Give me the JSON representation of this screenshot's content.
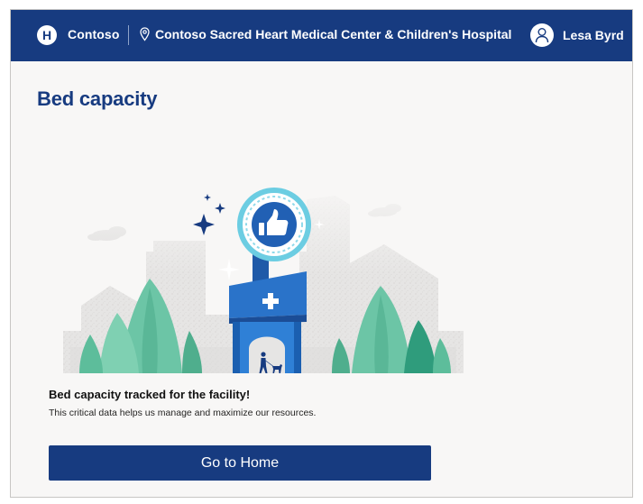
{
  "header": {
    "logo_letter": "H",
    "brand": "Contoso",
    "facility": "Contoso Sacred Heart Medical Center & Children's Hospital",
    "user_name": "Lesa Byrd"
  },
  "page": {
    "title": "Bed capacity"
  },
  "message": {
    "title": "Bed capacity tracked for the facility!",
    "body": "This critical data helps us manage and maximize our resources."
  },
  "actions": {
    "home_label": "Go to Home"
  },
  "colors": {
    "brand_navy": "#173b80",
    "accent_blue": "#2a73c9",
    "badge_cyan": "#6ccde2",
    "tree_green": "#5fbf9e",
    "background": "#f8f7f6"
  },
  "icons": [
    "hospital-logo-icon",
    "location-pin-icon",
    "user-avatar-icon",
    "thumbs-up-icon",
    "medical-cross-icon",
    "sparkle-icon"
  ]
}
